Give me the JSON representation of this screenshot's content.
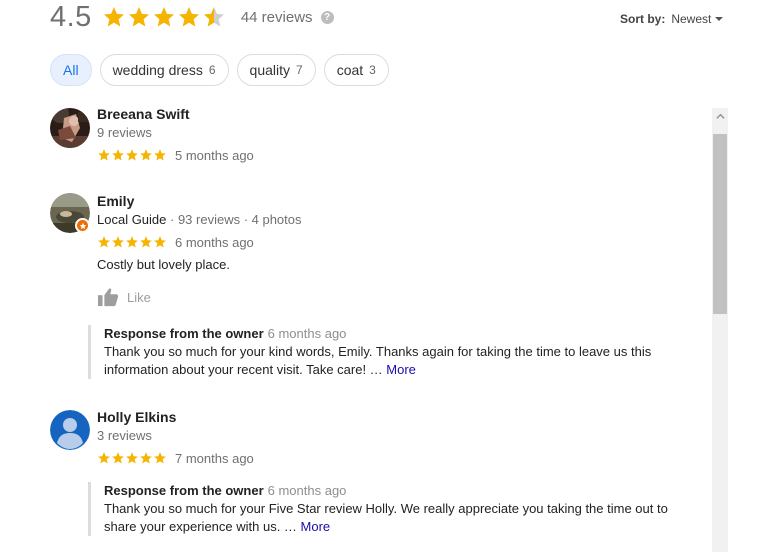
{
  "summary": {
    "rating": "4.5",
    "rating_value": 4.5,
    "review_count": "44 reviews",
    "help_icon": "?"
  },
  "sort": {
    "label": "Sort by:",
    "value": "Newest"
  },
  "chips": [
    {
      "label": "All",
      "count": ""
    },
    {
      "label": "wedding dress",
      "count": "6"
    },
    {
      "label": "quality",
      "count": "7"
    },
    {
      "label": "coat",
      "count": "3"
    }
  ],
  "reviews": [
    {
      "name": "Breeana Swift",
      "meta_plain": "9 reviews",
      "stars": 5,
      "date": "5 months ago"
    },
    {
      "name": "Emily",
      "meta_guide": "Local Guide",
      "meta_rest": " · 93 reviews · 4 photos",
      "stars": 5,
      "date": "6 months ago",
      "text": "Costly but lovely place.",
      "like": "Like",
      "owner": {
        "title": "Response from the owner",
        "date": "6 months ago",
        "text": "Thank you so much for your kind words, Emily. Thanks again for taking the time to leave us this information about your recent visit. Take care! … ",
        "more": "More"
      }
    },
    {
      "name": "Holly Elkins",
      "meta_plain": "3 reviews",
      "stars": 5,
      "date": "7 months ago",
      "owner": {
        "title": "Response from the owner",
        "date": "6 months ago",
        "text": "Thank you so much for your Five Star review Holly. We really appreciate you taking the time out to share your experience with us. … ",
        "more": "More"
      }
    }
  ],
  "colors": {
    "star": "#f5b400",
    "star_empty": "#cfcfcf",
    "link": "#1a0dab",
    "chip_active": "#1a73e8"
  },
  "icons": [
    "star-icon",
    "help-icon",
    "caret-down-icon",
    "thumbs-up-icon",
    "chevron-up-icon",
    "avatar-photo",
    "local-guide-badge-icon",
    "default-user-icon"
  ]
}
